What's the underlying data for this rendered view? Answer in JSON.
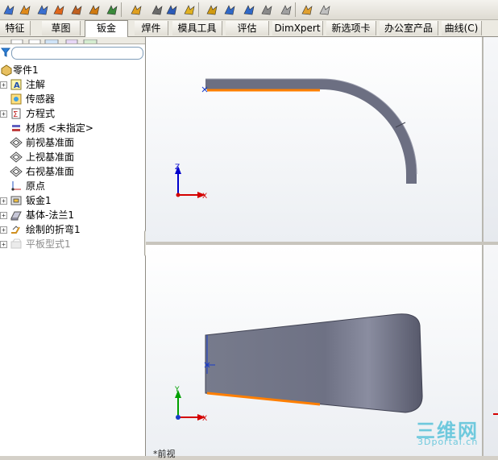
{
  "toolbar": {
    "icons": [
      "sheet-metal-flange-icon",
      "insert-bends-icon",
      "edge-flange-icon",
      "miter-flange-icon",
      "hem-icon",
      "jog-icon",
      "sketched-bend-icon",
      "cross-break-icon",
      "unfold-icon",
      "fold-icon",
      "flatten-icon",
      "no-bends-icon",
      "rip-icon",
      "insert-bends-icon",
      "extruded-cut-icon",
      "simple-hole-icon",
      "vent-icon",
      "convert-icon",
      "forming-tool-icon"
    ]
  },
  "tabs": [
    "特征",
    "草图",
    "钣金",
    "焊件",
    "模具工具",
    "评估",
    "DimXpert",
    "新选项卡",
    "办公室产品",
    "曲线(C)"
  ],
  "active_tab": "钣金",
  "tree": {
    "root": "零件1",
    "items": [
      {
        "label": "注解",
        "icon": "annotation-icon",
        "expandable": true
      },
      {
        "label": "传感器",
        "icon": "sensor-icon",
        "expandable": false
      },
      {
        "label": "方程式",
        "icon": "equation-icon",
        "expandable": true
      },
      {
        "label": "材质 <未指定>",
        "icon": "material-icon",
        "expandable": false
      },
      {
        "label": "前视基准面",
        "icon": "plane-icon",
        "expandable": false
      },
      {
        "label": "上视基准面",
        "icon": "plane-icon",
        "expandable": false
      },
      {
        "label": "右视基准面",
        "icon": "plane-icon",
        "expandable": false
      },
      {
        "label": "原点",
        "icon": "origin-icon",
        "expandable": false
      },
      {
        "label": "钣金1",
        "icon": "sheet-metal-icon",
        "expandable": true
      },
      {
        "label": "基体-法兰1",
        "icon": "base-flange-icon",
        "expandable": true
      },
      {
        "label": "绘制的折弯1",
        "icon": "sketched-bend-icon",
        "expandable": true
      },
      {
        "label": "平板型式1",
        "icon": "flat-pattern-icon",
        "expandable": true,
        "suppressed": true
      }
    ]
  },
  "axes": {
    "x": "X",
    "y": "Y",
    "z": "Z"
  },
  "view_label": "*前视",
  "watermark": {
    "main": "三维网",
    "sub": "3Dportal.cn"
  },
  "colors": {
    "part": "#6c6f82",
    "edge": "#ff7f00",
    "axis_x": "#d40000",
    "axis_y": "#00a000",
    "axis_z": "#0000cc"
  }
}
